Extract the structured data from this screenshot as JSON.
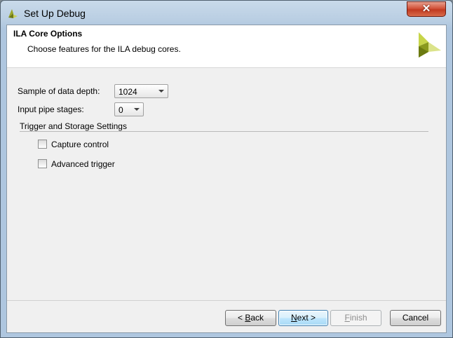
{
  "window": {
    "title": "Set Up Debug",
    "close_label": "✕"
  },
  "header": {
    "title": "ILA Core Options",
    "subtitle": "Choose features for the ILA debug cores."
  },
  "fields": {
    "data_depth": {
      "label": "Sample of data depth:",
      "value": "1024"
    },
    "pipe_stages": {
      "label": "Input pipe stages:",
      "value": "0"
    }
  },
  "section": {
    "title": "Trigger and Storage Settings",
    "checkboxes": [
      {
        "label": "Capture control",
        "checked": false
      },
      {
        "label": "Advanced trigger",
        "checked": false
      }
    ]
  },
  "buttons": {
    "back": {
      "pre": "< ",
      "mnemonic": "B",
      "rest": "ack"
    },
    "next": {
      "mnemonic": "N",
      "rest": "ext >"
    },
    "finish": {
      "mnemonic": "F",
      "rest": "inish"
    },
    "cancel": {
      "label": "Cancel"
    }
  },
  "colors": {
    "logo_light": "#c7d54a",
    "logo_dark": "#8a9a1e",
    "primary_border": "#3c7fb1"
  }
}
